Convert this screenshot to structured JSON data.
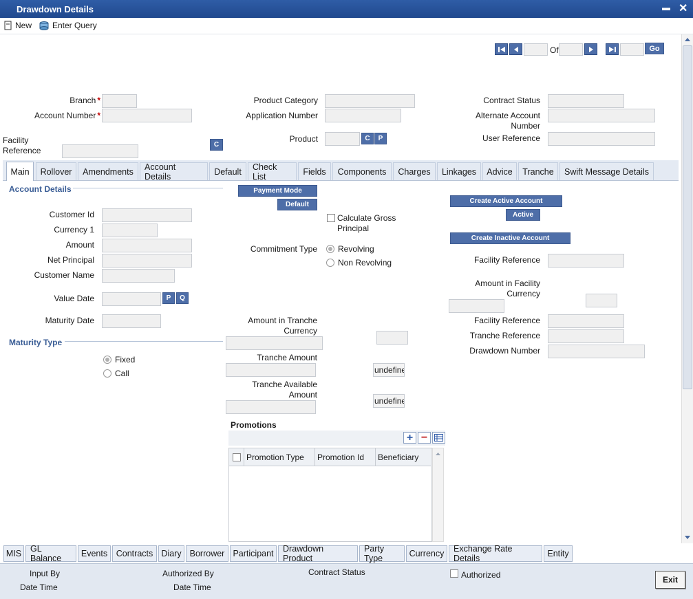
{
  "window": {
    "title": "Drawdown Details",
    "minimize": "▬",
    "close": "✕"
  },
  "toolbar": {
    "new_label": "New",
    "enter_query_label": "Enter Query"
  },
  "pager": {
    "of_label": "Of",
    "go_label": "Go"
  },
  "header": {
    "branch_label": "Branch",
    "account_number_label": "Account Number",
    "facility_reference_label": "Facility Reference",
    "facility_c_button": "C",
    "product_category_label": "Product Category",
    "application_number_label": "Application Number",
    "product_label": "Product",
    "product_c_button": "C",
    "product_p_button": "P",
    "contract_status_label": "Contract Status",
    "alternate_account_label": "Alternate Account Number",
    "user_reference_label": "User Reference",
    "required_mark": "*"
  },
  "tabs": [
    "Main",
    "Rollover",
    "Amendments",
    "Account Details",
    "Default",
    "Check List",
    "Fields",
    "Components",
    "Charges",
    "Linkages",
    "Advice",
    "Tranche",
    "Swift Message Details"
  ],
  "main": {
    "account_details_header": "Account Details",
    "customer_id_label": "Customer Id",
    "currency_label": "Currency 1",
    "amount_label": "Amount",
    "net_principal_label": "Net Principal",
    "customer_name_label": "Customer Name",
    "value_date_label": "Value Date",
    "value_date_p": "P",
    "value_date_q": "Q",
    "maturity_date_label": "Maturity Date",
    "maturity_type_header": "Maturity Type",
    "maturity_fixed": "Fixed",
    "maturity_call": "Call",
    "payment_mode_button": "Payment Mode",
    "default_button": "Default",
    "calculate_gross_label": "Calculate Gross Principal",
    "commitment_type_label": "Commitment Type",
    "commitment_revolving": "Revolving",
    "commitment_non_revolving": "Non Revolving",
    "amount_tranche_ccy_label": "Amount in Tranche Currency",
    "tranche_amount_label": "Tranche Amount",
    "tranche_amount_value": "undefined",
    "tranche_available_label": "Tranche Available Amount",
    "tranche_available_value": "undefined",
    "create_active_button": "Create Active Account",
    "active_button": "Active",
    "create_inactive_button": "Create Inactive Account",
    "facility_reference_label": "Facility Reference",
    "amount_facility_ccy_label": "Amount in Facility Currency",
    "facility_reference2_label": "Facility Reference",
    "tranche_reference_label": "Tranche Reference",
    "drawdown_number_label": "Drawdown Number"
  },
  "promotions": {
    "title": "Promotions",
    "add": "+",
    "remove": "−",
    "columns": [
      "Promotion Type",
      "Promotion Id",
      "Beneficiary"
    ]
  },
  "bottom_tabs": [
    "MIS",
    "GL Balance",
    "Events",
    "Contracts",
    "Diary",
    "Borrower",
    "Participant",
    "Drawdown Product",
    "Party Type",
    "Currency",
    "Exchange Rate Details",
    "Entity"
  ],
  "footer": {
    "input_by": "Input By",
    "date_time1": "Date Time",
    "authorized_by": "Authorized By",
    "date_time2": "Date Time",
    "contract_status": "Contract Status",
    "authorized": "Authorized",
    "exit": "Exit"
  },
  "colors": {
    "title_bar": "#20488e",
    "button": "#4e6ea8",
    "section_header": "#3b5e96"
  }
}
